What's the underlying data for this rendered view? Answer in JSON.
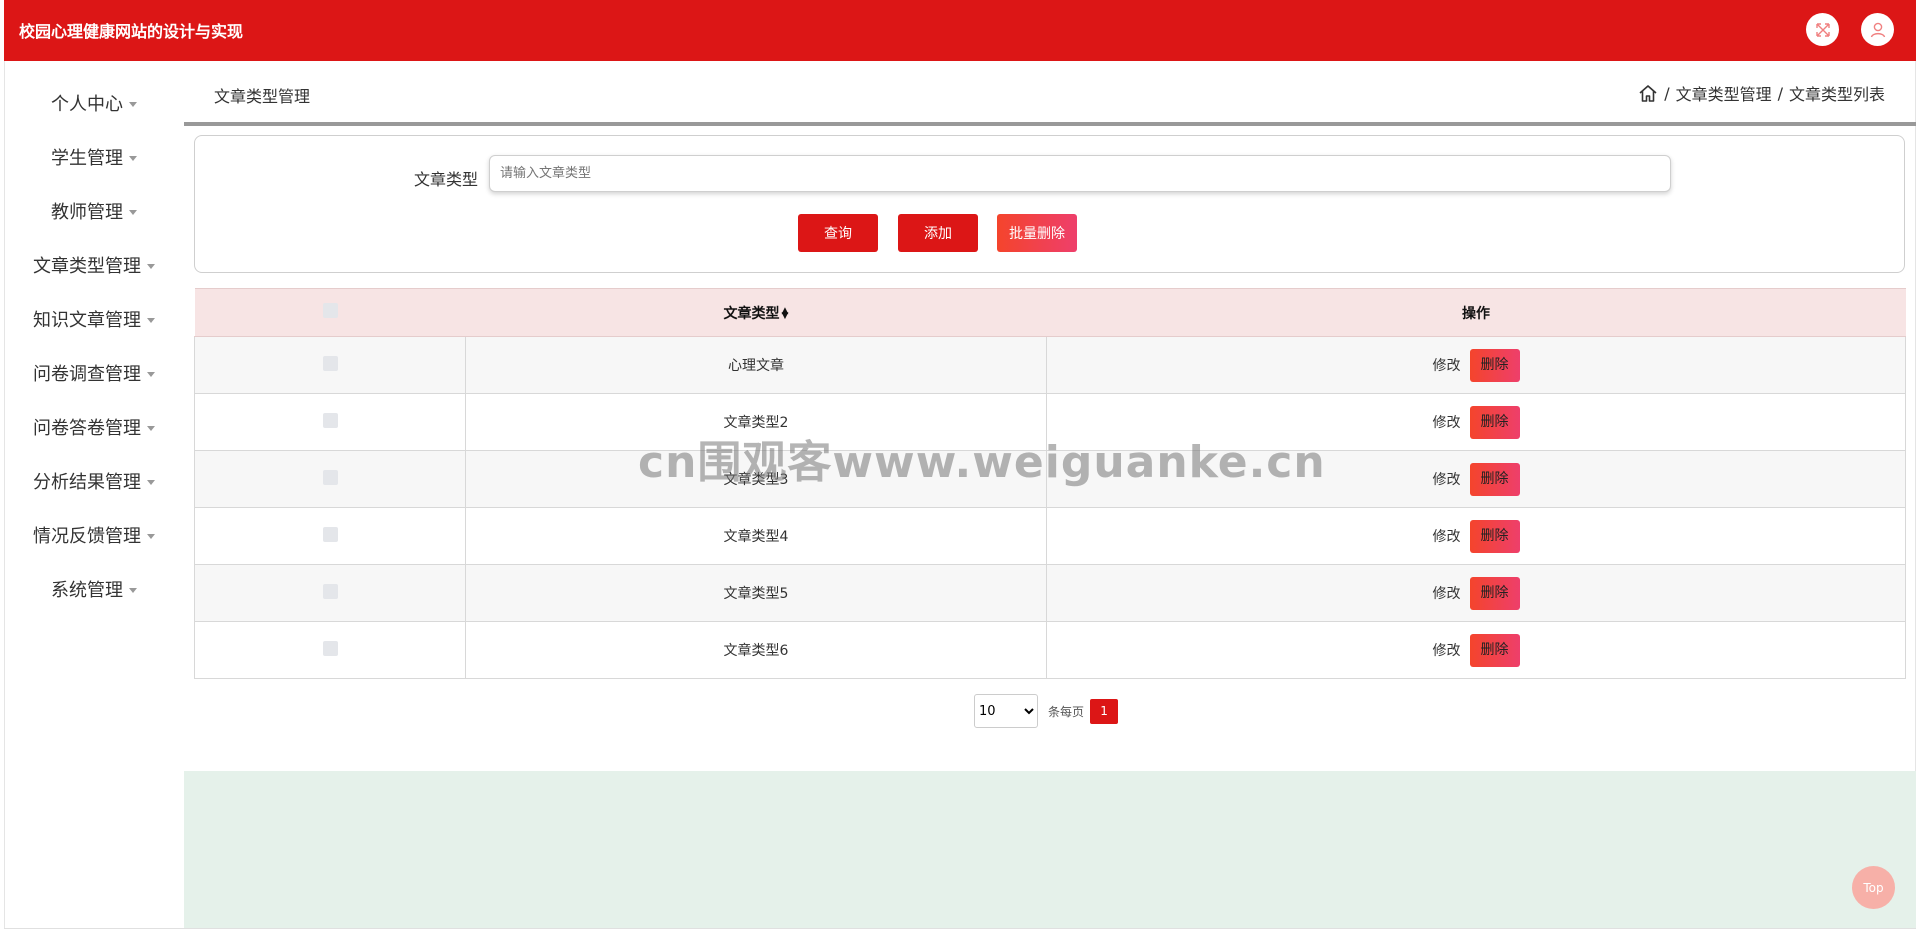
{
  "header": {
    "title": "校园心理健康网站的设计与实现"
  },
  "sidebar": {
    "items": [
      {
        "label": "个人中心"
      },
      {
        "label": "学生管理"
      },
      {
        "label": "教师管理"
      },
      {
        "label": "文章类型管理"
      },
      {
        "label": "知识文章管理"
      },
      {
        "label": "问卷调查管理"
      },
      {
        "label": "问卷答卷管理"
      },
      {
        "label": "分析结果管理"
      },
      {
        "label": "情况反馈管理"
      },
      {
        "label": "系统管理"
      }
    ]
  },
  "page": {
    "title": "文章类型管理",
    "breadcrumb": [
      "文章类型管理",
      "文章类型列表"
    ]
  },
  "search": {
    "label": "文章类型",
    "placeholder": "请输入文章类型",
    "query_label": "查询",
    "add_label": "添加",
    "batch_delete_label": "批量删除"
  },
  "table": {
    "headers": [
      "文章类型",
      "操作"
    ],
    "rows": [
      {
        "type": "心理文章"
      },
      {
        "type": "文章类型2"
      },
      {
        "type": "文章类型3"
      },
      {
        "type": "文章类型4"
      },
      {
        "type": "文章类型5"
      },
      {
        "type": "文章类型6"
      }
    ],
    "edit_label": "修改",
    "delete_label": "删除"
  },
  "pagination": {
    "page_size": "10",
    "per_page_label": "条每页",
    "current_page": "1"
  },
  "top_button": "Top",
  "watermark": "cn围观客www.weiguanke.cn",
  "colors": {
    "primary": "#dc1616",
    "header_row": "#f7e4e4",
    "footer_area": "#e5f1ea"
  }
}
